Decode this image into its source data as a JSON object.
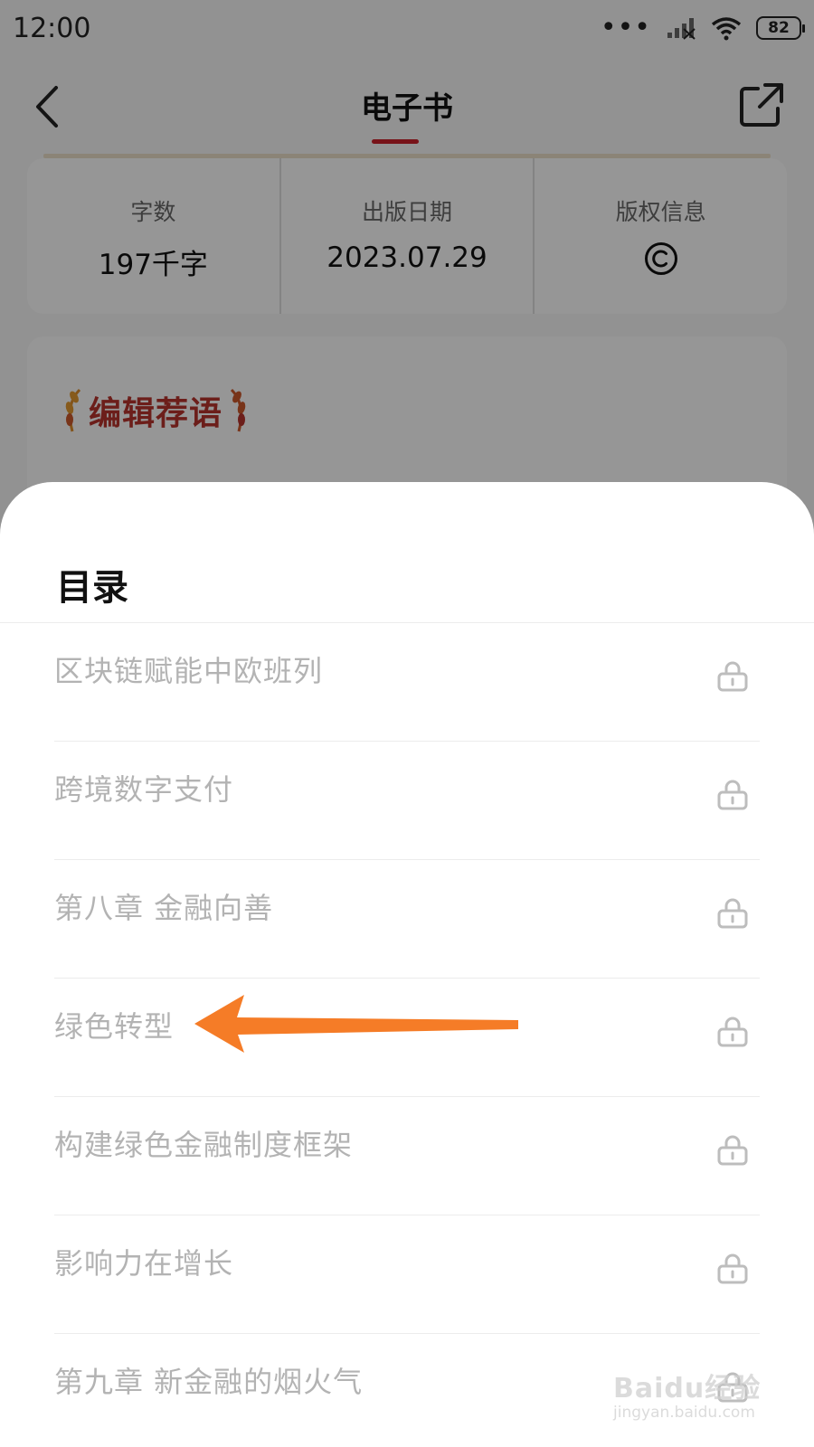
{
  "status_bar": {
    "time": "12:00",
    "battery": "82"
  },
  "nav": {
    "title": "电子书"
  },
  "info": {
    "word_count": {
      "label": "字数",
      "value": "197千字"
    },
    "publish_date": {
      "label": "出版日期",
      "value": "2023.07.29"
    },
    "copyright": {
      "label": "版权信息",
      "icon": "copyright-icon"
    }
  },
  "editor": {
    "title": "编辑荐语"
  },
  "toc": {
    "title": "目录",
    "items": [
      {
        "label": "区块链赋能中欧班列",
        "locked": true
      },
      {
        "label": "跨境数字支付",
        "locked": true
      },
      {
        "label": "第八章 金融向善",
        "locked": true
      },
      {
        "label": "绿色转型",
        "locked": true
      },
      {
        "label": "构建绿色金融制度框架",
        "locked": true
      },
      {
        "label": "影响力在增长",
        "locked": true
      },
      {
        "label": "第九章 新金融的烟火气",
        "locked": true
      }
    ]
  },
  "annotation": {
    "type": "arrow",
    "color": "#f57c27",
    "points_to": "绿色转型"
  },
  "watermark": {
    "main": "Baidu经验",
    "sub": "jingyan.baidu.com"
  },
  "colors": {
    "accent": "#c8202a",
    "annotation": "#f57c27",
    "muted_text": "#b3b3b3"
  }
}
